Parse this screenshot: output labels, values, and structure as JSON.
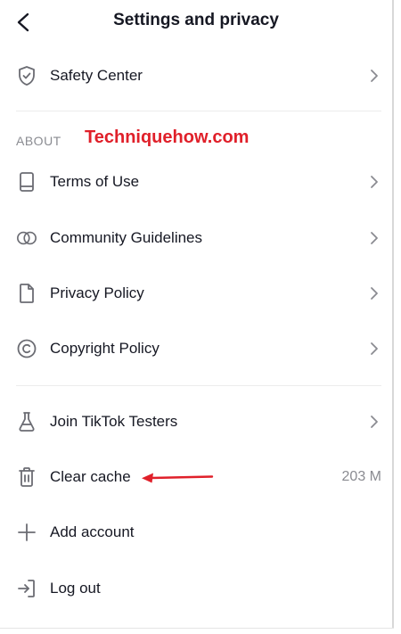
{
  "header": {
    "title": "Settings and privacy",
    "back_icon": "chevron-left-icon"
  },
  "rows": {
    "safety_center": {
      "label": "Safety Center",
      "icon": "shield-check-icon"
    },
    "terms": {
      "label": "Terms of Use",
      "icon": "book-icon"
    },
    "community": {
      "label": "Community Guidelines",
      "icon": "overlapping-circles-icon"
    },
    "privacy": {
      "label": "Privacy Policy",
      "icon": "document-icon"
    },
    "copyright": {
      "label": "Copyright Policy",
      "icon": "copyright-icon"
    },
    "testers": {
      "label": "Join TikTok Testers",
      "icon": "flask-icon"
    },
    "clear_cache": {
      "label": "Clear cache",
      "value": "203 M",
      "icon": "trash-icon"
    },
    "add_account": {
      "label": "Add account",
      "icon": "plus-icon"
    },
    "logout": {
      "label": "Log out",
      "icon": "logout-icon"
    }
  },
  "sections": {
    "about": "ABOUT"
  },
  "watermark": {
    "text": "Techniquehow.com",
    "color": "#e0202a"
  },
  "colors": {
    "text": "#161823",
    "secondary": "#8a8b91",
    "icon": "#6b6c73",
    "annotation_arrow": "#e0202a"
  }
}
